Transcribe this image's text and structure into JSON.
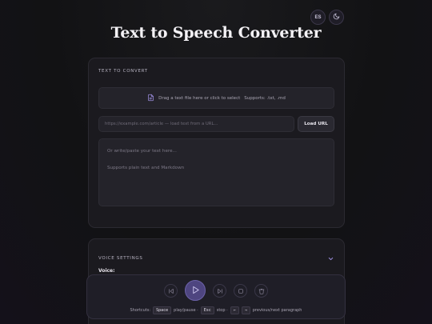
{
  "header": {
    "lang_button": "ES",
    "theme_icon": "moon-icon",
    "title": "Text to Speech Converter"
  },
  "text_card": {
    "section_label": "TEXT TO CONVERT",
    "dropzone": {
      "icon": "file-text-icon",
      "text": "Drag a text file here or click to select",
      "supports": "Supports: .txt, .md"
    },
    "url": {
      "placeholder": "https://example.com/article — load text from a URL...",
      "value": "",
      "button_label": "Load URL"
    },
    "textarea": {
      "placeholder": "Or write/paste your text here...\n\nSupports plain text and Markdown"
    }
  },
  "voice_card": {
    "section_label": "VOICE SETTINGS",
    "toggle_icon": "chevron-down-icon",
    "voice_label": "Voice:"
  },
  "player": {
    "controls": [
      {
        "name": "previous-button",
        "icon": "skip-back-icon"
      },
      {
        "name": "play-button",
        "icon": "play-icon"
      },
      {
        "name": "next-button",
        "icon": "skip-forward-icon"
      },
      {
        "name": "stop-button",
        "icon": "stop-icon"
      },
      {
        "name": "clear-button",
        "icon": "trash-icon"
      }
    ],
    "shortcuts": {
      "prefix": "Shortcuts:",
      "space_key": "Space",
      "space_action": "play/pause ·",
      "esc_key": "Esc",
      "esc_action": "stop ·",
      "left_key": "←",
      "right_key": "→",
      "arrows_action": "previous/next paragraph"
    }
  },
  "colors": {
    "accent": "#4e4580",
    "background": "#121214",
    "card": "#1b1a1f"
  }
}
